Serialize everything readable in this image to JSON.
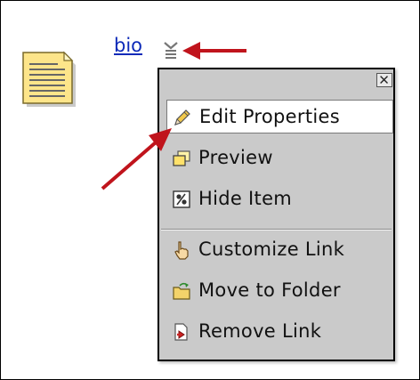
{
  "item": {
    "link_text": "bio",
    "icon": "document-icon"
  },
  "menu_trigger": {
    "icon": "chevron-down-icon"
  },
  "context_menu": {
    "close_icon": "close-icon",
    "items": [
      {
        "label": "Edit Properties",
        "icon": "pencil-icon",
        "highlighted": true
      },
      {
        "label": "Preview",
        "icon": "preview-window-icon"
      },
      {
        "label": "Hide Item",
        "icon": "hide-item-icon"
      },
      {
        "label": "Customize Link",
        "icon": "pointer-hand-icon"
      },
      {
        "label": "Move to Folder",
        "icon": "move-to-folder-icon"
      },
      {
        "label": "Remove Link",
        "icon": "remove-link-icon"
      }
    ]
  },
  "annotations": {
    "arrow_color": "#c0141c"
  },
  "colors": {
    "link": "#0d2ab8",
    "menu_bg": "#cacaca",
    "highlight_bg": "#ffffff"
  }
}
